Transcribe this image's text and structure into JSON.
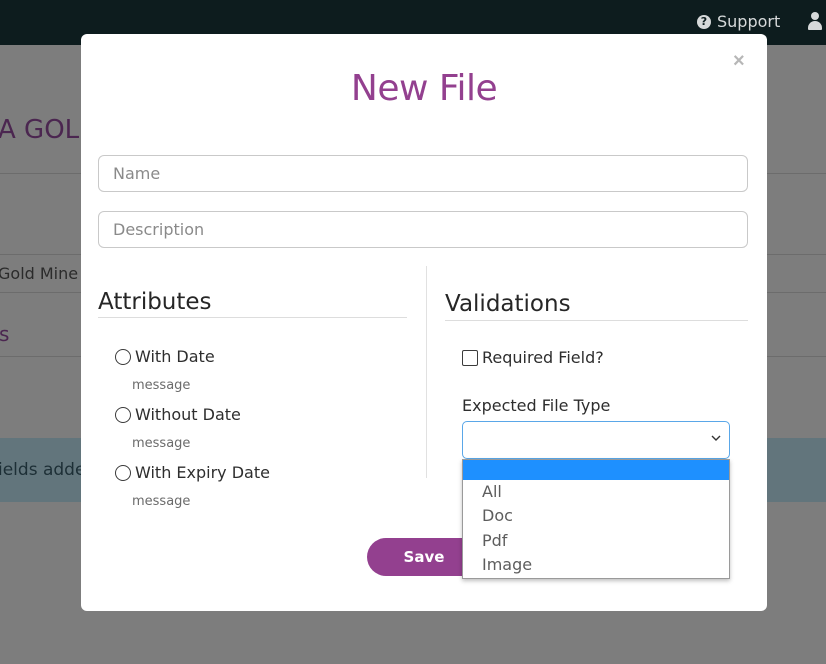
{
  "topbar": {
    "support_label": "Support",
    "support_icon": "question-circle-icon",
    "user_icon": "user-icon"
  },
  "background": {
    "title_fragment": "A GOL",
    "row_fragment": "Gold Mine S",
    "section_fragment": "s",
    "alert_fragment": "ields adde"
  },
  "modal": {
    "title": "New File",
    "close_glyph": "×",
    "name_placeholder": "Name",
    "description_placeholder": "Description",
    "attributes": {
      "heading": "Attributes",
      "options": [
        {
          "label": "With Date",
          "message": "message"
        },
        {
          "label": "Without Date",
          "message": "message"
        },
        {
          "label": "With Expiry Date",
          "message": "message"
        }
      ]
    },
    "validations": {
      "heading": "Validations",
      "required_label": "Required Field?",
      "file_type_label": "Expected File Type",
      "file_type_value": "",
      "file_type_options": [
        "",
        "All",
        "Doc",
        "Pdf",
        "Image"
      ]
    },
    "save_label": "Save"
  },
  "colors": {
    "accent": "#93408f",
    "selected_option": "#1e90ff",
    "topbar": "#0d1c1e"
  }
}
